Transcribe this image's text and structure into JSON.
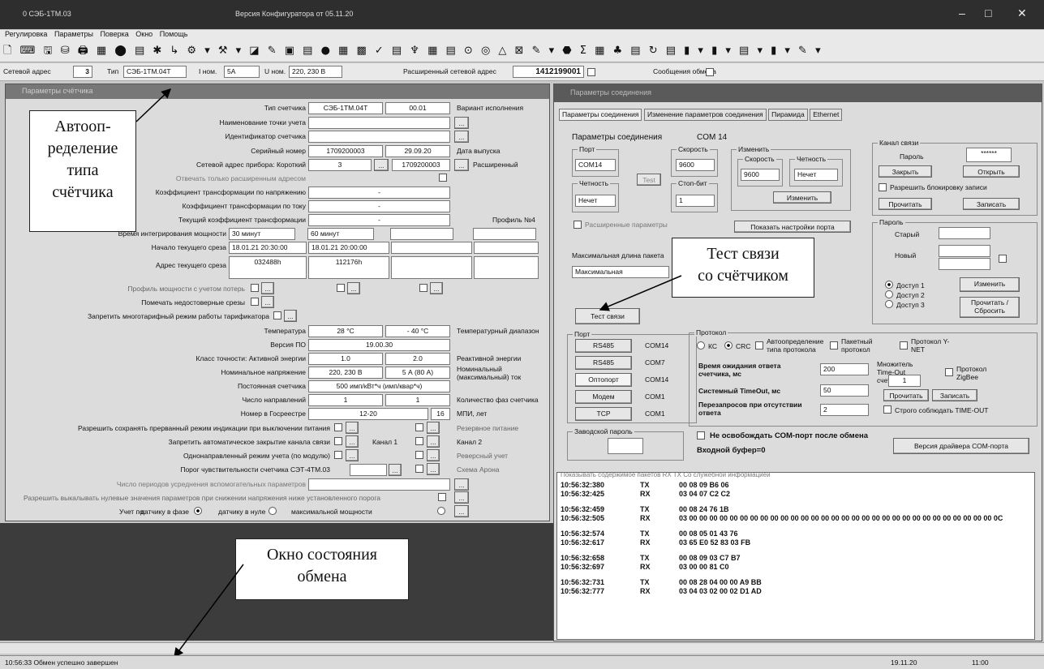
{
  "titlebar": {
    "doc": "0 СЭБ-1ТМ.03",
    "version": "Версия Конфигуратора  от 05.11.20",
    "minimize": "–",
    "maximize": "□",
    "close": "✕"
  },
  "menu": [
    "Регулировка",
    "Параметры",
    "Поверка",
    "Окно",
    "Помощь"
  ],
  "toolbar_glyphs": "🗋 ⌨ 🖫 ⛁ 🖨 ▦ ⬤ ▤ ✱ ↳ ⚙ ▾ ⚒ ▾ ◪ ✎ ▣ ▤ ● ▦ ▩ ✓ ▤ ♆ ▦ ▤ ⊙ ◎ △ ⊠ ✎ ▾ ⬣ Σ ▦ ♣ ▤ ↻ ▤ ▮ ▾ ▮ ▾ ▤ ▾ ▮ ▾ ✎ ▾",
  "addr": {
    "net_label": "Сетевой адрес",
    "net_value": "3",
    "type_label": "Тип",
    "type_value": "СЭБ-1ТМ.04Т",
    "inom_label": "I ном.",
    "inom_value": "5A",
    "unom_label": "U ном.",
    "unom_value": "220, 230 В",
    "ext_label": "Расширенный сетевой адрес",
    "ext_value": "1412199001",
    "msg_label": "Сообщения обмена"
  },
  "param": {
    "title": "Параметры счётчика",
    "type_label": "Тип счетчика",
    "type_value": "СЭБ-1ТМ.04Т",
    "variant_value": "00.01",
    "variant_label": "Вариант исполнения",
    "point_label": "Наименование точки учета",
    "id_label": "Идентификатор счетчика",
    "serial_label": "Серийный номер",
    "serial_value": "1709200003",
    "date_value": "29.09.20",
    "date_label": "Дата выпуска",
    "net_label": "Сетевой адрес прибора: Короткий",
    "net_short": "3",
    "net_ext": "1709200003",
    "net_ext_label": "Расширенный",
    "reply_ext_label": "Отвечать только расширенным адресом",
    "ktn_label": "Коэффициент трансформации по напряжению",
    "ktn_value": "-",
    "ktt_label": "Коэффициент трансформации по току",
    "ktt_value": "-",
    "kt_label": "Текущий коэффициент трансформации",
    "kt_value": "-",
    "profile_label": "Профиль №4",
    "interval_label": "Время интегрирования мощности",
    "interval_1": "30 минут",
    "interval_2": "60 минут",
    "slice_start_label": "Начало текущего среза",
    "slice_start_1": "18.01.21 20:30:00",
    "slice_start_2": "18.01.21 20:00:00",
    "slice_addr_label": "Адрес текущего среза",
    "slice_addr_1": "032488h",
    "slice_addr_2": "112176h",
    "loss_label": "Профиль мощности с учетом потерь",
    "mark_label": "Помечать недостоверные срезы",
    "tariff_label": "Запретить многотарифный режим работы тарификатора",
    "temp_label": "Температура",
    "temp_1": "28 °С",
    "temp_2": "- 40 °С",
    "temp_range_label": "Температурный диапазон",
    "sw_label": "Версия ПО",
    "sw_value": "19.00.30",
    "acc_label": "Класс точности: Активной энергии",
    "acc_1": "1.0",
    "acc_2": "2.0",
    "acc_react_label": "Реактивной энергии",
    "unom_label": "Номинальное напряжение",
    "unom_value": "220, 230 В",
    "inom_value": "5 А (80 А)",
    "inom_label": "Номинальный (максимальный) ток",
    "const_label": "Постоянная счетчика",
    "const_value": "500 имп/кВт*ч (имп/квар*ч)",
    "dirs_label": "Число направлений",
    "dirs_value": "1",
    "phases_value": "1",
    "phases_label": "Количество фаз счетчика",
    "reg_label": "Номер в Госреестре",
    "reg_value": "12-20",
    "mpi_value": "16",
    "mpi_label": "МПИ, лет",
    "save_mode_label": "Разрешить сохранять прерванный режим индикации при выключении питания",
    "reserve_label": "Резервное питание",
    "autoclose_label": "Запретить автоматическое закрытие канала связи",
    "ch1_label": "Канал 1",
    "ch2_label": "Канал 2",
    "unidir_label": "Однонаправленный режим учета (по модулю)",
    "revers_label": "Реверсный учет",
    "sens_label": "Порог чувствительности счетчика СЭТ-4ТМ.03",
    "arona_label": "Схема Арона",
    "avg_label": "Число периодов усреднения вспомогательных параметров",
    "zero_label": "Разрешить выкалывать нулевые значения параметров при снижении напряжения ниже установленного порога",
    "meter_label": "Учет по:",
    "meter_opt1": "датчику в фазе",
    "meter_opt2": "датчику в нуле",
    "meter_opt3": "максимальной мощности",
    "dots": "..."
  },
  "conn": {
    "title": "Параметры соединения",
    "tabs": [
      "Параметры соединения",
      "Изменение параметров соединения",
      "Пирамида",
      "Ethernet"
    ],
    "group_title": "Параметры соединения",
    "com_label": "COM 14",
    "port_label": "Порт",
    "port_value": "COM14",
    "speed_label": "Скорость",
    "speed_value": "9600",
    "change_label": "Изменить",
    "speed2_label": "Скорость",
    "speed2_value": "9600",
    "parity2_label": "Четность",
    "parity2_value": "Нечет",
    "parity_label": "Четность",
    "parity_value": "Нечет",
    "stop_label": "Стоп-бит",
    "stop_value": "1",
    "test_small": "Test",
    "change_btn": "Изменить",
    "ext_params": "Расширенные параметры",
    "show_port": "Показать настройки порта",
    "maxlen_label": "Максимальная длина пакета",
    "maxlen_value": "Максимальная",
    "test_btn": "Тест связи",
    "port_group": "Порт",
    "ports": [
      {
        "btn": "RS485",
        "com": "COM14"
      },
      {
        "btn": "RS485",
        "com": "COM7"
      },
      {
        "btn": "Оптопорт",
        "com": "COM14"
      },
      {
        "btn": "Модем",
        "com": "COM1"
      },
      {
        "btn": "TCP",
        "com": "COM1"
      }
    ],
    "proto_group": "Протокол",
    "kc": "КС",
    "crc": "CRC",
    "auto_proto": "Автоопределение типа протокола",
    "packet": "Пакетный протокол",
    "ynet": "Протокол Y-NET",
    "wait_label": "Время ожидания ответа счетчика, мс",
    "wait_value": "200",
    "timeout_mult": "Множитель Time-Out счетчика",
    "timeout_mult_value": "1",
    "sys_label": "Системный TimeOut, мс",
    "sys_value": "50",
    "zigbee": "Протокол ZigBee",
    "retry_label": "Перезапросов при отсутствии ответа",
    "retry_value": "2",
    "read_btn": "Прочитать",
    "write_btn": "Записать",
    "strict": "Строго соблюдать TIME-OUT",
    "factory_pwd": "Заводской пароль",
    "no_release": "Не освобождать СОМ-порт после обмена",
    "buffer": "Входной буфер=0",
    "driver_btn": "Версия драйвера СОМ-порта",
    "chan_group": "Канал связи",
    "pwd_label": "Пароль",
    "pwd_value": "******",
    "close_btn": "Закрыть",
    "open_btn": "Открыть",
    "allow_lock": "Разрешить блокировку записи",
    "read2": "Прочитать",
    "write2": "Записать",
    "pwd_group": "Пароль",
    "old_label": "Старый",
    "new_label": "Новый",
    "access": [
      "Доступ 1",
      "Доступ 2",
      "Доступ 3"
    ],
    "change_pwd": "Изменить",
    "read_reset": "Прочитать / Сбросить"
  },
  "log": {
    "header": "Показывать содержимое пакетов   RX  TX  Со служебной информацией",
    "rows": [
      {
        "t": "10:56:32:380",
        "d": "TX",
        "v": "00 08 09 B6 06"
      },
      {
        "t": "10:56:32:425",
        "d": "RX",
        "v": "03 04 07 C2 C2"
      },
      {
        "t": "10:56:32:459",
        "d": "TX",
        "v": "00 08 24 76 1B"
      },
      {
        "t": "10:56:32:505",
        "d": "RX",
        "v": "03 00 00 00 00 00 00 00 00 00 00 00 00 00 00 00 00 00 00 00 00 00 00 00 00 00 00 00 00 00 00 0C"
      },
      {
        "t": "10:56:32:574",
        "d": "TX",
        "v": "00 08 05 01 43 76"
      },
      {
        "t": "10:56:32:617",
        "d": "RX",
        "v": "03 65 E0 52 83 03 FB"
      },
      {
        "t": "10:56:32:658",
        "d": "TX",
        "v": "00 08 09 03 C7 B7"
      },
      {
        "t": "10:56:32:697",
        "d": "RX",
        "v": "03 00 00 81 C0"
      },
      {
        "t": "10:56:32:731",
        "d": "TX",
        "v": "00 08 28 04 00 00 A9 BB"
      },
      {
        "t": "10:56:32:777",
        "d": "RX",
        "v": "03 04 03 02 00 02 D1 AD"
      }
    ]
  },
  "callouts": {
    "auto": "Автооп-\nределение\nтипа\nсчётчика",
    "test": "Тест связи\nсо счётчиком",
    "status": "Окно состояния\nобмена"
  },
  "status": {
    "msg": "10:56:33  Обмен успешно завершен",
    "date": "19.11.20",
    "time": "11:00"
  }
}
